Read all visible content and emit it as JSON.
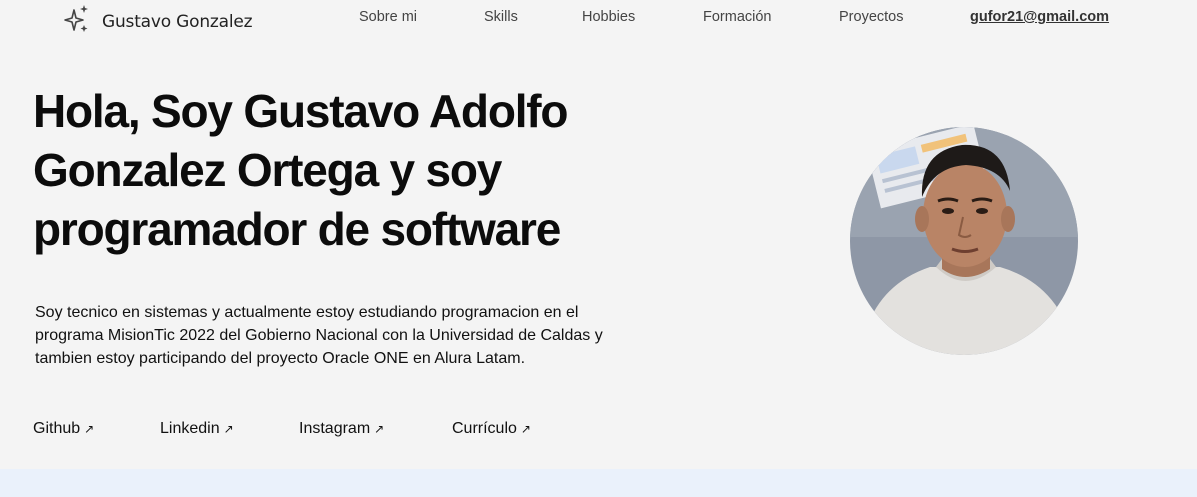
{
  "brand": {
    "name": "Gustavo Gonzalez",
    "icon": "sparkle-icon"
  },
  "nav": {
    "items": [
      "Sobre mi",
      "Skills",
      "Hobbies",
      "Formación",
      "Proyectos"
    ],
    "email": "gufor21@gmail.com"
  },
  "hero": {
    "title": "Hola, Soy Gustavo Adolfo Gonzalez Ortega y soy programador de software",
    "description": "Soy tecnico en sistemas y actualmente estoy estudiando programacion en el programa MisionTic 2022 del Gobierno Nacional con la Universidad de Caldas y tambien estoy participando del proyecto Oracle ONE en Alura Latam."
  },
  "links": [
    {
      "label": "Github",
      "arrow": "↗"
    },
    {
      "label": "Linkedin",
      "arrow": "↗"
    },
    {
      "label": "Instagram",
      "arrow": "↗"
    },
    {
      "label": "Currículo",
      "arrow": "↗"
    }
  ],
  "colors": {
    "background": "#f4f4f4",
    "band": "#eaf1fb",
    "text": "#111111"
  }
}
